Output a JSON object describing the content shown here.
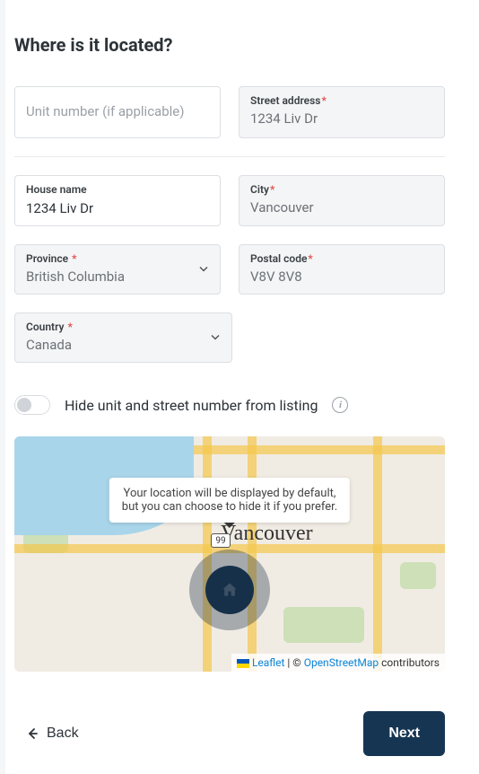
{
  "title": "Where is it located?",
  "fields": {
    "unit": {
      "placeholder": "Unit number (if applicable)",
      "value": ""
    },
    "street": {
      "label": "Street address",
      "required": true,
      "value": "1234 Liv Dr"
    },
    "house": {
      "label": "House name",
      "required": false,
      "value": "1234 Liv Dr"
    },
    "city": {
      "label": "City",
      "required": true,
      "value": "Vancouver"
    },
    "province": {
      "label": "Province",
      "required": true,
      "value": "British Columbia"
    },
    "postal": {
      "label": "Postal code",
      "required": true,
      "value": "V8V 8V8"
    },
    "country": {
      "label": "Country",
      "required": true,
      "value": "Canada"
    }
  },
  "toggle": {
    "label": "Hide unit and street number from listing",
    "on": false
  },
  "map": {
    "tooltip_line1": "Your location will be displayed by default,",
    "tooltip_line2": "but you can choose to hide it if you prefer.",
    "city_label": "Vancouver",
    "highway_badge": "99",
    "attribution": {
      "leaflet": "Leaflet",
      "osm": "OpenStreetMap",
      "suffix": " contributors",
      "sep": " | © "
    }
  },
  "footer": {
    "back": "Back",
    "next": "Next"
  }
}
